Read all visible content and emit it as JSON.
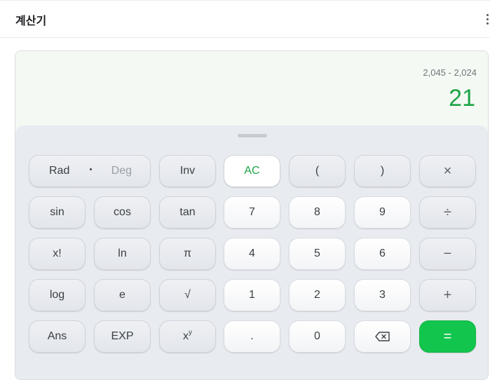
{
  "header": {
    "title": "계산기"
  },
  "display": {
    "expression": "2,045 - 2,024",
    "result": "21"
  },
  "keys": {
    "rad": "Rad",
    "deg": "Deg",
    "inv": "Inv",
    "ac": "AC",
    "lparen": "(",
    "rparen": ")",
    "multiply": "×",
    "sin": "sin",
    "cos": "cos",
    "tan": "tan",
    "seven": "7",
    "eight": "8",
    "nine": "9",
    "divide": "÷",
    "factorial": "x!",
    "ln": "ln",
    "pi": "π",
    "four": "4",
    "five": "5",
    "six": "6",
    "minus": "−",
    "log": "log",
    "e": "e",
    "sqrt": "√",
    "one": "1",
    "two": "2",
    "three": "3",
    "plus": "+",
    "ans": "Ans",
    "exp": "EXP",
    "power_base": "x",
    "power_exp": "y",
    "dot": ".",
    "zero": "0",
    "equals": "="
  },
  "colors": {
    "accent": "#1ea446",
    "equals_bg": "#12c54d"
  }
}
